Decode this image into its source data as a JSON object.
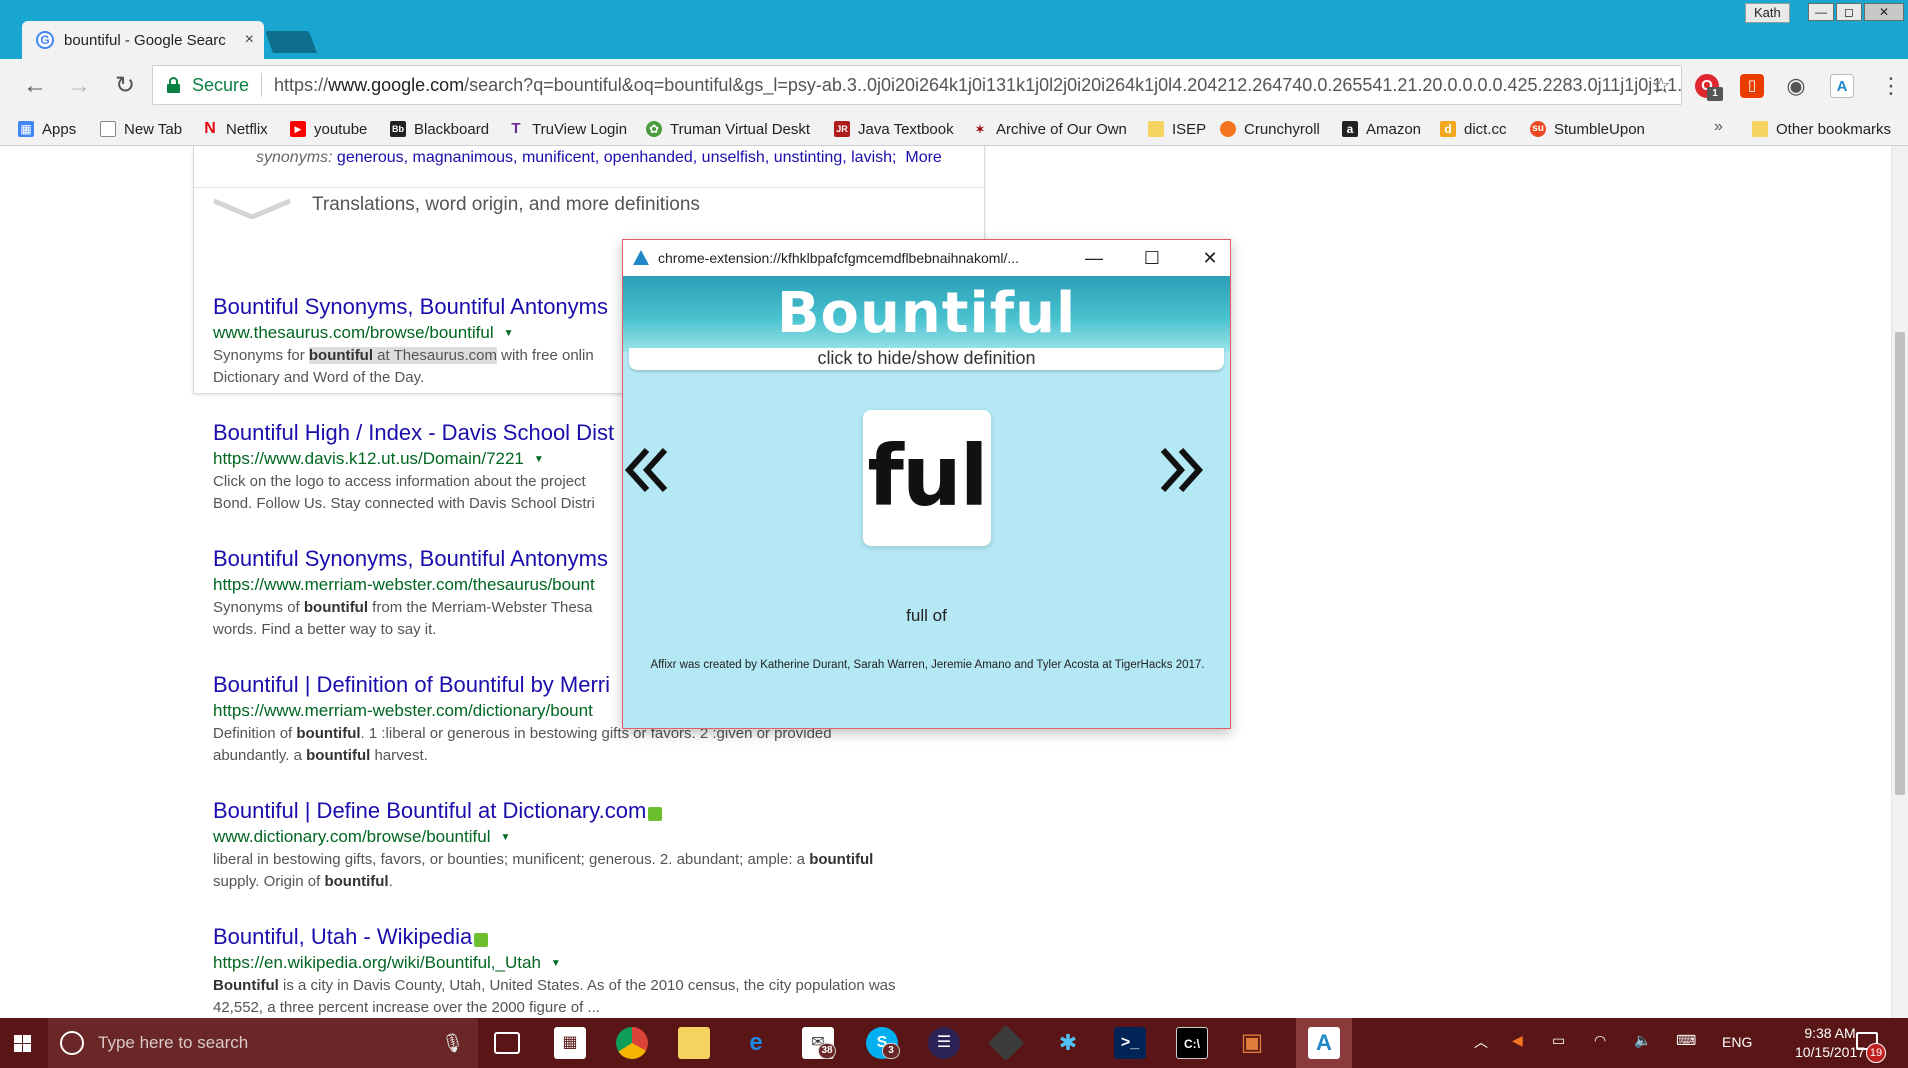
{
  "browser": {
    "tab_title": "bountiful - Google Searc",
    "tab_close": "×",
    "favicon_letter": "G",
    "user_name": "Kath",
    "window_controls": {
      "minimize": "—",
      "maximize": "◻",
      "close": "✕"
    }
  },
  "toolbar": {
    "back": "←",
    "forward": "→",
    "reload": "↻",
    "secure_label": "Secure",
    "url_prefix": "https://",
    "url_host": "www.google.com",
    "url_path": "/search?q=bountiful&oq=bountiful&gs_l=psy-ab.3..0j0i20i264k1j0i131k1j0l2j0i20i264k1j0l4.204212.264740.0.265541.21.20.0.0.0.0.425.2283.0j11j1j0j1.1...",
    "star": "☆",
    "opera_badge": "1",
    "menu": "⋮"
  },
  "bookmarks": {
    "items": [
      {
        "label": "Apps",
        "icon": "apps-grid-icon",
        "color": "#4285f4"
      },
      {
        "label": "New Tab",
        "icon": "page-icon",
        "color": "#888888"
      },
      {
        "label": "Netflix",
        "icon": "netflix-icon",
        "color": "#e50914"
      },
      {
        "label": "youtube",
        "icon": "youtube-icon",
        "color": "#ff0000"
      },
      {
        "label": "Blackboard",
        "icon": "blackboard-icon",
        "color": "#222222"
      },
      {
        "label": "TruView Login",
        "icon": "truview-icon",
        "color": "#6a2c91"
      },
      {
        "label": "Truman Virtual Deskt",
        "icon": "citrix-icon",
        "color": "#4a9d3c"
      },
      {
        "label": "Java Textbook",
        "icon": "java-textbook-icon",
        "color": "#b01d1d"
      },
      {
        "label": "Archive of Our Own",
        "icon": "ao3-icon",
        "color": "#990000"
      },
      {
        "label": "ISEP",
        "icon": "folder-icon",
        "color": "#f4d35e"
      },
      {
        "label": "Crunchyroll",
        "icon": "crunchyroll-icon",
        "color": "#f47521"
      },
      {
        "label": "Amazon",
        "icon": "amazon-icon",
        "color": "#222222"
      },
      {
        "label": "dict.cc",
        "icon": "dictcc-icon",
        "color": "#f2a81d"
      },
      {
        "label": "StumbleUpon",
        "icon": "stumbleupon-icon",
        "color": "#eb4924"
      }
    ],
    "more": "»",
    "other_bookmarks": "Other bookmarks"
  },
  "knowledge_card": {
    "synonyms_label": "synonyms:",
    "synonyms": [
      "generous,",
      "magnanimous,",
      "munificent,",
      "openhanded,",
      "unselfish,",
      "unstinting,",
      "lavish;"
    ],
    "more_link": "More",
    "more_definitions": "Translations, word origin, and more definitions"
  },
  "results": [
    {
      "title": "Bountiful Synonyms, Bountiful Antonyms",
      "url": "www.thesaurus.com/browse/bountiful",
      "snippet_pre": "Synonyms for ",
      "snippet_bold": "bountiful",
      "snippet_hl": " at Thesaurus.com",
      "snippet_post": " with free onlin",
      "snippet_line2": "Dictionary and Word of the Day.",
      "verified": false
    },
    {
      "title": "Bountiful High / Index - Davis School Dist",
      "url": "https://www.davis.k12.ut.us/Domain/7221",
      "snippet_line1": "Click on the logo to access information about the project",
      "snippet_line2": "Bond. Follow Us. Stay connected with Davis School Distri",
      "verified": false
    },
    {
      "title": "Bountiful Synonyms, Bountiful Antonyms",
      "url": "https://www.merriam-webster.com/thesaurus/bount",
      "snippet_pre": "Synonyms of ",
      "snippet_bold": "bountiful",
      "snippet_post": " from the Merriam-Webster Thesa",
      "snippet_line2": "words. Find a better way to say it.",
      "verified": false
    },
    {
      "title": "Bountiful | Definition of Bountiful by Merri",
      "url": "https://www.merriam-webster.com/dictionary/bount",
      "snippet_pre": "Definition of ",
      "snippet_bold": "bountiful",
      "snippet_post": ". 1 :liberal or generous in bestowing gifts or favors. 2 :given or provided",
      "snippet_line2_pre": "abundantly. a ",
      "snippet_line2_bold": "bountiful",
      "snippet_line2_post": " harvest.",
      "verified": false
    },
    {
      "title": "Bountiful | Define Bountiful at Dictionary.com",
      "url": "www.dictionary.com/browse/bountiful",
      "snippet_pre": "liberal in bestowing gifts, favors, or bounties; munificent; generous. 2. abundant; ample: a ",
      "snippet_bold": "bountiful",
      "snippet_line2_pre": "supply. Origin of ",
      "snippet_line2_bold": "bountiful",
      "snippet_line2_post": ".",
      "verified": true
    },
    {
      "title": "Bountiful, Utah - Wikipedia",
      "url": "https://en.wikipedia.org/wiki/Bountiful,_Utah",
      "snippet_bold": "Bountiful",
      "snippet_post": " is a city in Davis County, Utah, United States. As of the 2010 census, the city population was",
      "snippet_line2": "42,552, a three percent increase over the 2000 figure of ...",
      "verified": true
    }
  ],
  "popup": {
    "window_url": "chrome-extension://kfhklbpafcfgmcemdflbebnaihnakoml/...",
    "minimize": "—",
    "maximize": "☐",
    "close": "✕",
    "word": "Bountiful",
    "hint": "click to hide/show definition",
    "affix": "ful",
    "meaning": "full of",
    "credit": "Affixr was created by Katherine Durant, Sarah Warren, Jeremie Amano and Tyler Acosta at TigerHacks 2017."
  },
  "taskbar": {
    "search_placeholder": "Type here to search",
    "mail_badge": "38",
    "skype_badge": "3",
    "language": "ENG",
    "time": "9:38 AM",
    "date": "10/15/2017",
    "notification_count": "19"
  },
  "colors": {
    "chrome_accent": "#19a7d2",
    "link_blue": "#1a0dab",
    "url_green": "#006621",
    "popup_bg": "#b3e8f4",
    "taskbar": "#5a1616"
  }
}
